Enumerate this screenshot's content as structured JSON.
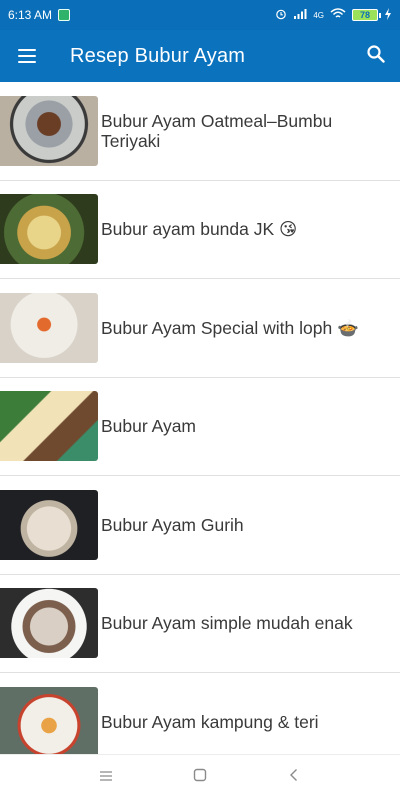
{
  "status_bar": {
    "time": "6:13 AM",
    "battery": "78",
    "network_label": "4G"
  },
  "app_bar": {
    "title": "Resep Bubur Ayam",
    "icons": [
      "menu-icon",
      "search-icon"
    ]
  },
  "recipes": [
    {
      "title": "Bubur Ayam Oatmeal–Bumbu Teriyaki"
    },
    {
      "title": "Bubur ayam bunda JK 😘"
    },
    {
      "title": "Bubur Ayam Special with loph 🍲"
    },
    {
      "title": "Bubur Ayam"
    },
    {
      "title": "Bubur Ayam Gurih"
    },
    {
      "title": "Bubur Ayam simple mudah enak"
    },
    {
      "title": "Bubur Ayam kampung & teri"
    }
  ],
  "colors": {
    "primary": "#0b72bd",
    "status_bar": "#0a6fb8",
    "text": "#3a3a3a",
    "divider": "#e0e0e0"
  }
}
